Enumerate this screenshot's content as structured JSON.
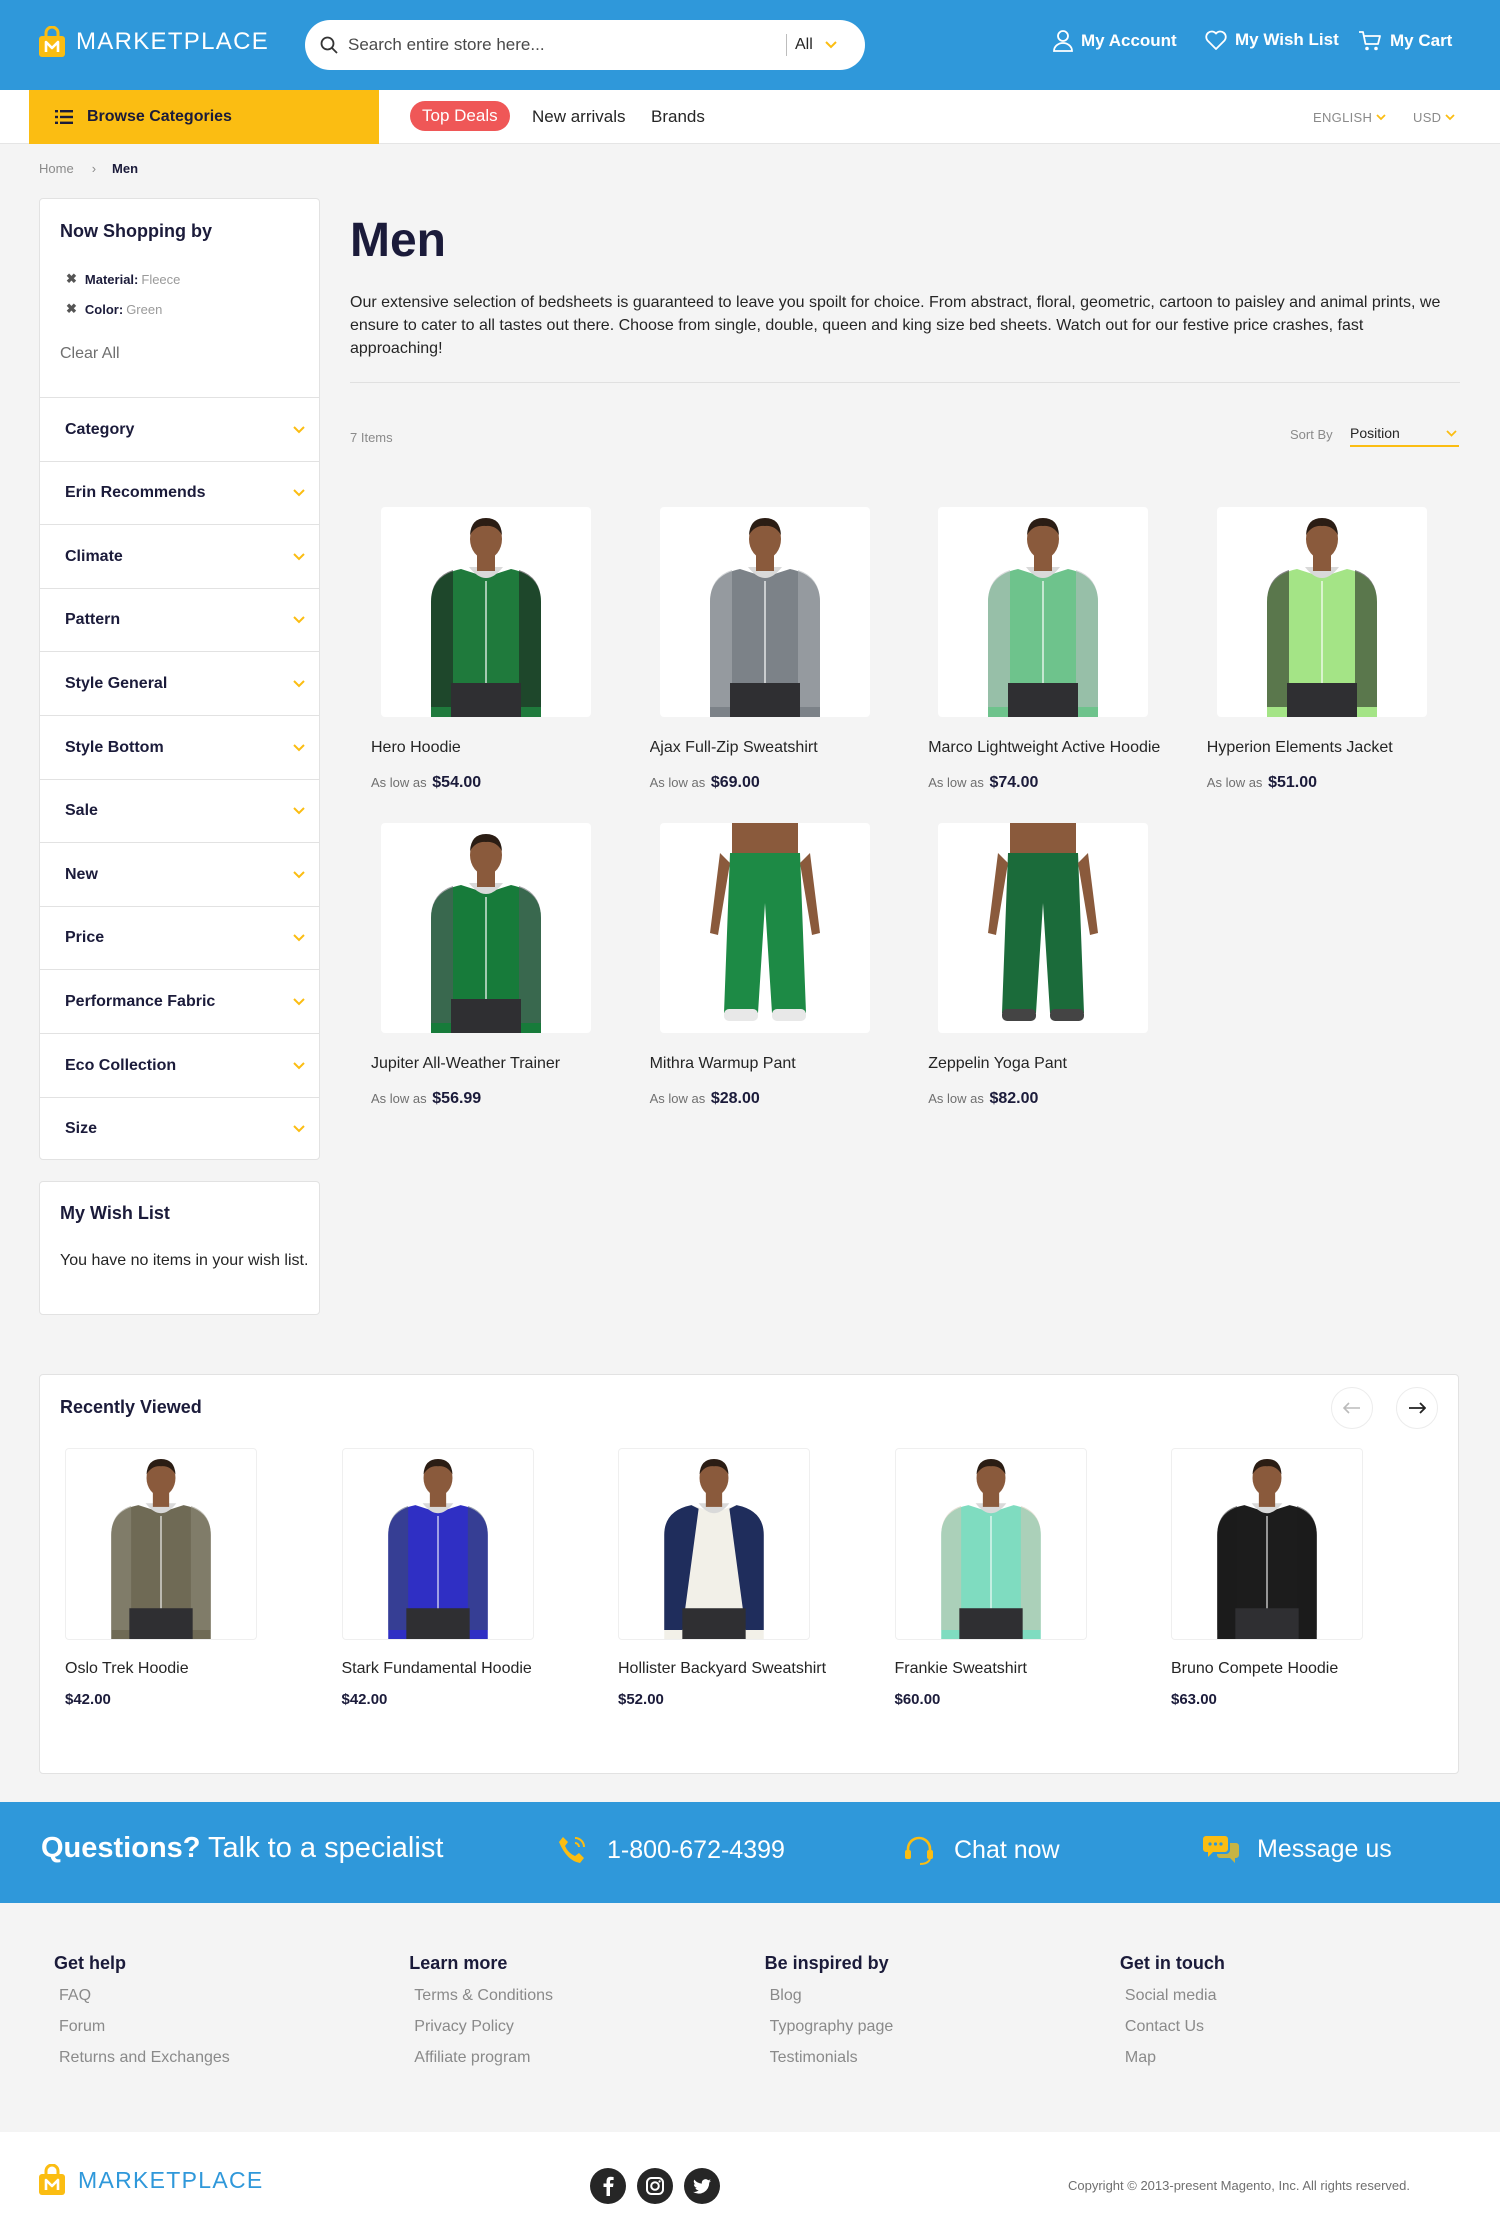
{
  "header": {
    "logo_text": "MARKETPLACE",
    "search_placeholder": "Search entire store here...",
    "search_category": "All",
    "my_account": "My Account",
    "my_wishlist": "My Wish List",
    "my_cart": "My Cart",
    "brand_color": "#2f98da",
    "accent_color": "#fbbd12"
  },
  "nav": {
    "browse": "Browse Categories",
    "top_deals": "Top Deals",
    "new_arrivals": "New arrivals",
    "brands": "Brands",
    "language": "ENGLISH",
    "currency": "USD"
  },
  "breadcrumb": {
    "home": "Home",
    "current": "Men"
  },
  "sidebar": {
    "title": "Now Shopping by",
    "filters": [
      {
        "label": "Material:",
        "value": "Fleece"
      },
      {
        "label": "Color:",
        "value": "Green"
      }
    ],
    "clear_all": "Clear All",
    "facets": [
      "Category",
      "Erin Recommends",
      "Climate",
      "Pattern",
      "Style General",
      "Style Bottom",
      "Sale",
      "New",
      "Price",
      "Performance Fabric",
      "Eco Collection",
      "Size"
    ]
  },
  "wishlist": {
    "title": "My Wish List",
    "text": "You have no items in your wish list."
  },
  "main": {
    "title": "Men",
    "description": "Our extensive selection of bedsheets is guaranteed to leave you spoilt for choice. From abstract, floral, geometric, cartoon to paisley and animal prints, we ensure to cater to all tastes out there. Choose from single, double, queen and king size bed sheets. Watch out for our festive price crashes, fast approaching!",
    "item_count": "7 Items",
    "sort_label": "Sort By",
    "sort_value": "Position",
    "price_prefix": "As low as",
    "products": [
      {
        "name": "Hero Hoodie",
        "price": "$54.00",
        "kind": "hoodie",
        "color": "#1f7a3c",
        "accent": "#1d1d1d"
      },
      {
        "name": "Ajax Full-Zip Sweatshirt",
        "price": "$69.00",
        "kind": "hoodie",
        "color": "#7c8288",
        "accent": "#a9aeb2"
      },
      {
        "name": "Marco Lightweight Active Hoodie",
        "price": "$74.00",
        "kind": "hoodie",
        "color": "#6ec38c",
        "accent": "#b9bcbf"
      },
      {
        "name": "Hyperion Elements Jacket",
        "price": "$51.00",
        "kind": "jacket",
        "color": "#a4e486",
        "accent": "#1d1d1d"
      },
      {
        "name": "Jupiter All-Weather Trainer",
        "price": "$56.99",
        "kind": "jacket",
        "color": "#177b3a",
        "accent": "#555a5e"
      },
      {
        "name": "Mithra Warmup Pant",
        "price": "$28.00",
        "kind": "pant",
        "color": "#1d8a45",
        "accent": "#e8e8e8"
      },
      {
        "name": "Zeppelin Yoga Pant",
        "price": "$82.00",
        "kind": "pant",
        "color": "#1b6b3a",
        "accent": "#444"
      }
    ]
  },
  "recently_viewed": {
    "title": "Recently Viewed",
    "items": [
      {
        "name": "Oslo Trek Hoodie",
        "price": "$42.00",
        "kind": "hoodie",
        "color": "#6f6a55",
        "accent": "#8e8a7a"
      },
      {
        "name": "Stark Fundamental Hoodie",
        "price": "$42.00",
        "kind": "hoodie",
        "color": "#2f2fc4",
        "accent": "#3d4a6e"
      },
      {
        "name": "Hollister Backyard Sweatshirt",
        "price": "$52.00",
        "kind": "raglan",
        "color": "#f2f0e8",
        "accent": "#1f2d5c"
      },
      {
        "name": "Frankie Sweatshirt",
        "price": "$60.00",
        "kind": "jacket",
        "color": "#7fdcc0",
        "accent": "#cfc6b3"
      },
      {
        "name": "Bruno Compete Hoodie",
        "price": "$63.00",
        "kind": "hoodie",
        "color": "#1c1c1c",
        "accent": "#1c1c1c"
      }
    ]
  },
  "questions": {
    "strong": "Questions?",
    "rest": " Talk to a specialist",
    "phone": "1-800-672-4399",
    "chat": "Chat now",
    "message": "Message us"
  },
  "footer": {
    "columns": [
      {
        "title": "Get help",
        "links": [
          "FAQ",
          "Forum",
          "Returns and Exchanges"
        ]
      },
      {
        "title": "Learn more",
        "links": [
          "Terms & Conditions",
          "Privacy Policy",
          "Affiliate program"
        ]
      },
      {
        "title": "Be inspired by",
        "links": [
          "Blog",
          "Typography page",
          "Testimonials"
        ]
      },
      {
        "title": "Get in touch",
        "links": [
          "Social media",
          "Contact Us",
          "Map"
        ]
      }
    ],
    "logo_text": "MARKETPLACE",
    "copyright": "Copyright © 2013-present Magento, Inc. All rights reserved.",
    "social": [
      "facebook-icon",
      "instagram-icon",
      "twitter-icon"
    ]
  }
}
